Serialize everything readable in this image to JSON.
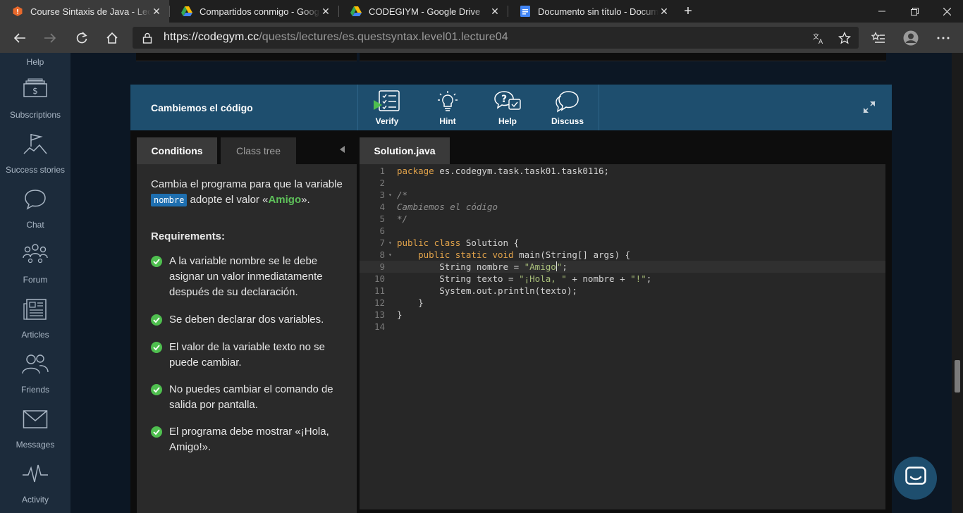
{
  "browser": {
    "tabs": [
      {
        "title": "Course Sintaxis de Java - Lecture",
        "active": true,
        "icon": "codegym-favicon"
      },
      {
        "title": "Compartidos conmigo - Google",
        "active": false,
        "icon": "google-drive-favicon"
      },
      {
        "title": "CODEGIYM - Google Drive",
        "active": false,
        "icon": "google-drive-favicon"
      },
      {
        "title": "Documento sin título - Documen",
        "active": false,
        "icon": "google-docs-favicon"
      }
    ],
    "new_tab": "+",
    "url_host": "https://codegym.cc",
    "url_path": "/quests/lectures/es.questsyntax.level01.lecture04"
  },
  "sidebar": {
    "items": [
      {
        "label": "Help",
        "icon": "help-icon"
      },
      {
        "label": "Subscriptions",
        "icon": "subscriptions-icon"
      },
      {
        "label": "Success stories",
        "icon": "success-stories-icon"
      },
      {
        "label": "Chat",
        "icon": "chat-icon"
      },
      {
        "label": "Forum",
        "icon": "forum-icon"
      },
      {
        "label": "Articles",
        "icon": "articles-icon"
      },
      {
        "label": "Friends",
        "icon": "friends-icon"
      },
      {
        "label": "Messages",
        "icon": "messages-icon"
      },
      {
        "label": "Activity",
        "icon": "activity-icon"
      }
    ]
  },
  "task": {
    "title": "Cambiemos el código",
    "buttons": [
      {
        "label": "Verify",
        "icon": "verify-icon"
      },
      {
        "label": "Hint",
        "icon": "hint-icon"
      },
      {
        "label": "Help",
        "icon": "help-icon"
      },
      {
        "label": "Discuss",
        "icon": "discuss-icon"
      }
    ]
  },
  "panel": {
    "tab_conditions": "Conditions",
    "tab_class_tree": "Class tree",
    "description": {
      "part1": "Cambia el programa para que la variable ",
      "variable": "nombre",
      "part2": " adopte el valor «",
      "value": "Amigo",
      "part3": "»."
    },
    "requirements_title": "Requirements:",
    "requirements": [
      "A la variable nombre se le debe asignar un valor inmediatamente después de su declaración.",
      "Se deben declarar dos variables.",
      "El valor de la variable texto no se puede cambiar.",
      "No puedes cambiar el comando de salida por pantalla.",
      "El programa debe mostrar «¡Hola, Amigo!»."
    ]
  },
  "editor": {
    "file_tab": "Solution.java",
    "current_line": 9,
    "lines": [
      {
        "n": "1",
        "fold": false,
        "segs": [
          [
            "kw",
            "package"
          ],
          [
            "",
            " es.codegym.task.task01.task0116;"
          ]
        ]
      },
      {
        "n": "2",
        "fold": false,
        "segs": []
      },
      {
        "n": "3",
        "fold": true,
        "segs": [
          [
            "cm",
            "/*"
          ]
        ]
      },
      {
        "n": "4",
        "fold": false,
        "segs": [
          [
            "cm",
            "Cambiemos el código"
          ]
        ]
      },
      {
        "n": "5",
        "fold": false,
        "segs": [
          [
            "cm",
            "*/"
          ]
        ]
      },
      {
        "n": "6",
        "fold": false,
        "segs": []
      },
      {
        "n": "7",
        "fold": true,
        "segs": [
          [
            "kw",
            "public class"
          ],
          [
            "",
            " Solution {"
          ]
        ]
      },
      {
        "n": "8",
        "fold": true,
        "segs": [
          [
            "",
            "    "
          ],
          [
            "kw",
            "public static void"
          ],
          [
            "",
            " main(String[] args) {"
          ]
        ]
      },
      {
        "n": "9",
        "fold": false,
        "segs": [
          [
            "",
            "        String nombre = "
          ],
          [
            "st",
            "\"Amigo"
          ],
          [
            "cursor",
            ""
          ],
          [
            "st",
            "\""
          ],
          [
            "",
            ";"
          ]
        ]
      },
      {
        "n": "10",
        "fold": false,
        "segs": [
          [
            "",
            "        String texto = "
          ],
          [
            "st",
            "\"¡Hola, \""
          ],
          [
            "",
            " + nombre + "
          ],
          [
            "st",
            "\"!\""
          ],
          [
            "",
            ";"
          ]
        ]
      },
      {
        "n": "11",
        "fold": false,
        "segs": [
          [
            "",
            "        System.out.println(texto);"
          ]
        ]
      },
      {
        "n": "12",
        "fold": false,
        "segs": [
          [
            "",
            "    }"
          ]
        ]
      },
      {
        "n": "13",
        "fold": false,
        "segs": [
          [
            "",
            "}"
          ]
        ]
      },
      {
        "n": "14",
        "fold": false,
        "segs": []
      }
    ]
  },
  "colors": {
    "header_blue": "#1e4e6e",
    "sidebar_bg": "#1c2b3b",
    "keyword": "#e0a24a",
    "string": "#a9bf7a",
    "check_green": "#4fbf4f"
  }
}
